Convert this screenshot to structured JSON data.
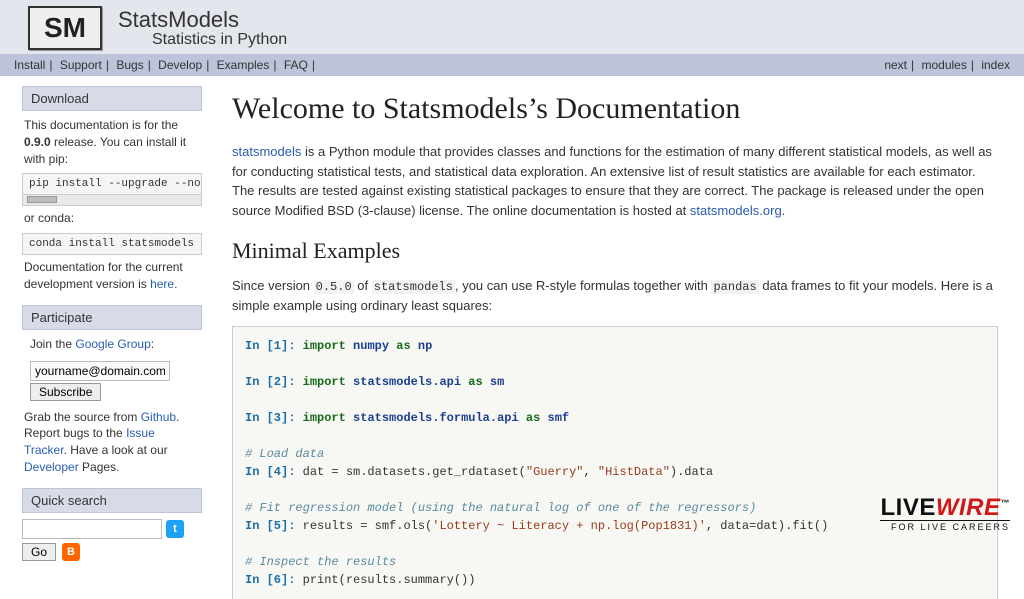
{
  "header": {
    "logo_mark": "SM",
    "brand": "StatsModels",
    "tagline": "Statistics in Python"
  },
  "nav": {
    "left": [
      "Install",
      "Support",
      "Bugs",
      "Develop",
      "Examples",
      "FAQ"
    ],
    "right": [
      "next",
      "modules",
      "index"
    ]
  },
  "sidebar": {
    "download": {
      "title": "Download",
      "intro_pre": "This documentation is for the ",
      "version": "0.9.0",
      "intro_post": " release. You can install it with pip:",
      "pip_cmd": "pip install --upgrade --no-deps",
      "or_conda": "or conda:",
      "conda_cmd": "conda install statsmodels",
      "curver_pre": "Documentation for the current development version is ",
      "curver_link": "here",
      "curver_post": "."
    },
    "participate": {
      "title": "Participate",
      "join_pre": "Join the ",
      "join_link": "Google Group",
      "join_post": ":",
      "email_placeholder": "yourname@domain.com",
      "subscribe_label": "Subscribe",
      "blurb_1a": "Grab the source from ",
      "blurb_1_link": "Github",
      "blurb_1b": ". Report bugs to the ",
      "blurb_2_link": "Issue Tracker",
      "blurb_2b": ". Have a look at our ",
      "blurb_3_link": "Developer",
      "blurb_3b": " Pages."
    },
    "search": {
      "title": "Quick search",
      "go_label": "Go"
    }
  },
  "main": {
    "h1": "Welcome to Statsmodels’s Documentation",
    "intro_link": "statsmodels",
    "intro_rest": " is a Python module that provides classes and functions for the estimation of many different statistical models, as well as for conducting statistical tests, and statistical data exploration. An extensive list of result statistics are available for each estimator. The results are tested against existing statistical packages to ensure that they are correct. The package is released under the open source Modified BSD (3-clause) license. The online documentation is hosted at ",
    "intro_link2": "statsmodels.org",
    "intro_end": ".",
    "h2": "Minimal Examples",
    "para2_a": "Since version ",
    "para2_ver": "0.5.0",
    "para2_b": " of ",
    "para2_mod": "statsmodels",
    "para2_c": ", you can use R-style formulas together with ",
    "para2_pd": "pandas",
    "para2_d": " data frames to fit your models. Here is a simple example using ordinary least squares:"
  },
  "code": {
    "l1_in": "In [1]:",
    "l1_kw": "import",
    "l1_mod": "numpy",
    "l1_as": "as",
    "l1_al": "np",
    "l2_in": "In [2]:",
    "l2_kw": "import",
    "l2_mod": "statsmodels.api",
    "l2_as": "as",
    "l2_al": "sm",
    "l3_in": "In [3]:",
    "l3_kw": "import",
    "l3_mod": "statsmodels.formula.api",
    "l3_as": "as",
    "l3_al": "smf",
    "c1": "# Load data",
    "l4_in": "In [4]:",
    "l4_body_a": "dat = sm.datasets.get_rdataset(",
    "l4_s1": "\"Guerry\"",
    "l4_comma": ", ",
    "l4_s2": "\"HistData\"",
    "l4_body_b": ").data",
    "c2": "# Fit regression model (using the natural log of one of the regressors)",
    "l5_in": "In [5]:",
    "l5_body_a": "results = smf.ols(",
    "l5_s1": "'Lottery ~ Literacy + np.log(Pop1831)'",
    "l5_body_b": ", data=dat).fit()",
    "c3": "# Inspect the results",
    "l6_in": "In [6]:",
    "l6_body": "print(results.summary())"
  },
  "watermark": {
    "black": "LIVE",
    "red": "WIRE",
    "tm": "™",
    "sub": "FOR LIVE CAREERS"
  }
}
